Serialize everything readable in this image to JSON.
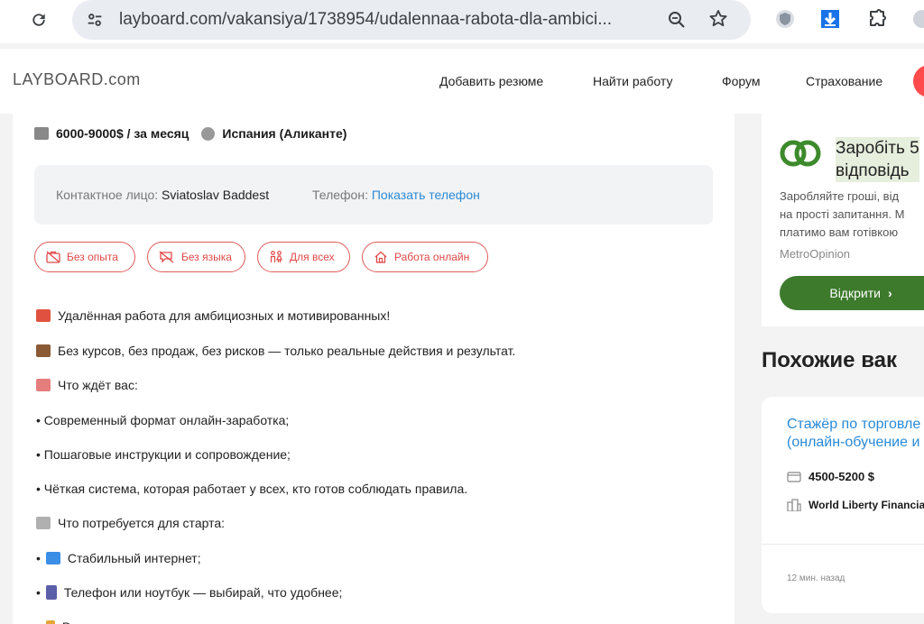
{
  "browser": {
    "url": "layboard.com/vakansiya/1738954/udalennaa-rabota-dla-ambici..."
  },
  "site": {
    "logo": "LAYBOARD.com",
    "nav": [
      "Добавить резюме",
      "Найти работу",
      "Форум",
      "Страхование"
    ]
  },
  "job": {
    "salary": "6000-9000$ / за месяц",
    "location": "Испания (Аликанте)",
    "contact_label": "Контактное лицо:",
    "contact_name": "Sviatoslav Baddest",
    "phone_label": "Телефон:",
    "phone_link": "Показать телефон",
    "tags": [
      "Без опыта",
      "Без языка",
      "Для всех",
      "Работа онлайн"
    ],
    "description": [
      "Удалённая работа для амбициозных и мотивированных!",
      "Без курсов, без продаж, без рисков — только реальные действия и результат.",
      "Что ждёт вас:",
      "• Современный формат онлайн-заработка;",
      "• Пошаговые инструкции и сопровождение;",
      "• Чёткая система, которая работает у всех, кто готов соблюдать правила.",
      "Что потребуется для старта:",
      "Стабильный интернет;",
      "Телефон или ноутбук — выбирай, что удобнее;",
      "В"
    ]
  },
  "ad": {
    "title_line1": "Заробіть 5",
    "title_line2": "відповідь",
    "body_line1": "Заробляйте гроші, від",
    "body_line2": "на прості запитання. М",
    "body_line3": "платимо вам готівкою",
    "source": "MetroOpinion",
    "button": "Відкрити"
  },
  "similar": {
    "title": "Похожие вак",
    "job_title_line1": "Стажёр по торговле",
    "job_title_line2": "(онлайн-обучение и",
    "salary": "4500-5200 $",
    "company": "World Liberty Financia",
    "time": "12 мин. назад"
  },
  "colors": {
    "accent_red": "#e04848",
    "link_blue": "#2a8ad6",
    "ad_green": "#3d7a2c"
  }
}
